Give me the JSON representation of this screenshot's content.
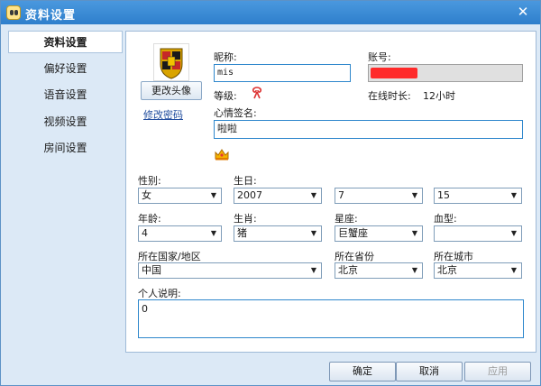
{
  "window": {
    "title": "资料设置",
    "close_glyph": "✕",
    "icon": "qq-penguin-icon"
  },
  "sidebar": {
    "items": [
      {
        "label": "资料设置",
        "active": true
      },
      {
        "label": "偏好设置",
        "active": false
      },
      {
        "label": "语音设置",
        "active": false
      },
      {
        "label": "视频设置",
        "active": false
      },
      {
        "label": "房间设置",
        "active": false
      }
    ]
  },
  "profile": {
    "change_avatar_label": "更改头像",
    "change_password_label": "修改密码",
    "nickname_label": "昵称:",
    "nickname_value": "mis",
    "account_label": "账号:",
    "account_value": "",
    "level_label": "等级:",
    "online_label": "在线时长:",
    "online_value": "12小时",
    "signature_label": "心情签名:",
    "signature_value": "啦啦",
    "gender_label": "性别:",
    "gender_value": "女",
    "birthday_label": "生日:",
    "birth_year": "2007",
    "birth_month": "7",
    "birth_day": "15",
    "age_label": "年龄:",
    "age_value": "4",
    "zodiac_label": "生肖:",
    "zodiac_value": "猪",
    "constellation_label": "星座:",
    "constellation_value": "巨蟹座",
    "blood_label": "血型:",
    "blood_value": "",
    "country_label": "所在国家/地区",
    "country_value": "中国",
    "province_label": "所在省份",
    "province_value": "北京",
    "city_label": "所在城市",
    "city_value": "北京",
    "desc_label": "个人说明:",
    "desc_value": "0"
  },
  "footer": {
    "ok_label": "确定",
    "cancel_label": "取消",
    "apply_label": "应用"
  },
  "colors": {
    "title_bar": "#3a8bd6",
    "redaction": "#ff2a2a",
    "focus_border": "#2e87cc"
  }
}
